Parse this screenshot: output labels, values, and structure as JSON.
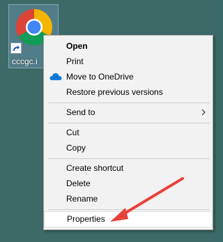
{
  "desktop": {
    "shortcut": {
      "label": "cccgc.i",
      "icon": "chrome-icon",
      "overlay_icon": "shortcut-arrow-icon"
    }
  },
  "context_menu": {
    "items": [
      {
        "label": "Open",
        "bold": true
      },
      {
        "label": "Print"
      },
      {
        "label": "Move to OneDrive",
        "icon": "onedrive-icon"
      },
      {
        "label": "Restore previous versions"
      },
      {
        "label": "Send to",
        "submenu": true
      },
      {
        "label": "Cut"
      },
      {
        "label": "Copy"
      },
      {
        "label": "Create shortcut"
      },
      {
        "label": "Delete"
      },
      {
        "label": "Rename"
      },
      {
        "label": "Properties",
        "highlighted": true
      }
    ]
  },
  "colors": {
    "desktop_bg": "#3d6a67",
    "menu_bg": "#f2f2f2",
    "annotation_arrow": "#e8413a",
    "onedrive_blue": "#0f78d4"
  }
}
